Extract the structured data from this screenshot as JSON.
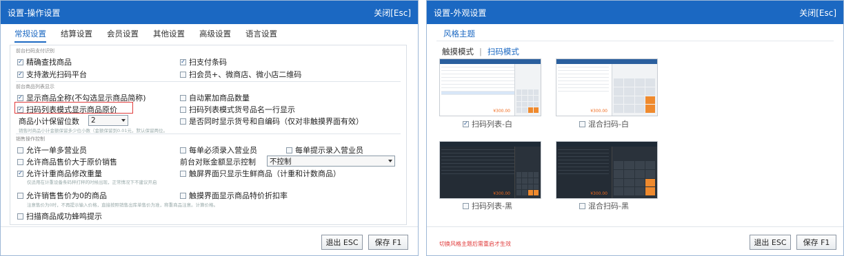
{
  "left": {
    "title": "设置-操作设置",
    "close": "关闭[Esc]",
    "tabs": [
      "常规设置",
      "结算设置",
      "会员设置",
      "其他设置",
      "高级设置",
      "语言设置"
    ],
    "groups": {
      "g1": "前台扫码支付识别",
      "g2": "前台商品列表显示",
      "g3": "销售操作控制"
    },
    "options": {
      "o1": "精确查找商品",
      "o2": "扫支付条码",
      "o3": "支持激光扫码平台",
      "o4": "扫会员+、微商店、微小店二维码",
      "o5": "显示商品全称(不勾选显示商品简称)",
      "o6": "自动累加商品数量",
      "o7": "扫码列表模式显示商品原价",
      "o8": "扫码列表模式货号品名一行显示",
      "o9": "是否同时显示货号和自编码（仅对非触摸界面有效）",
      "o10": "允许一单多营业员",
      "o11": "每单必须录入营业员",
      "o12": "每单提示录入营业员",
      "o13": "允许商品售价大于原价销售",
      "o14": "允许计重商品修改重量",
      "o15": "触屏界面只显示生鲜商品（计重和计数商品）",
      "o16": "允许销售售价为0的商品",
      "o17": "触摸界面显示商品特价折扣率",
      "o18": "扫描商品成功蜂鸣提示"
    },
    "decimal_label": "商品小计保留位数",
    "decimal_value": "2",
    "hint1": "销售时商品小计金额保留多少位小数（金额保留到0.01元，默认保留两位。",
    "hint2": "仅适用在计重设备条码秤打秤的时候出现，正常情况下不建议开启",
    "hint3": "注意售价为0时，不再提示输入价格，直接按照销售出库单售价为准，称重商品注意。计算价格。",
    "amount_label": "前台对账金额显示控制",
    "amount_value": "不控制",
    "btn_exit": "退出 ESC",
    "btn_save": "保存 F1"
  },
  "right": {
    "title": "设置-外观设置",
    "close": "关闭[Esc]",
    "theme_link": "风格主题",
    "mode_touch": "触摸模式",
    "mode_sep": "|",
    "mode_scan": "扫码模式",
    "themes": [
      "扫码列表-白",
      "混合扫码-白",
      "扫码列表-黑",
      "混合扫码-黑"
    ],
    "thumb_total": "¥300.00",
    "warning": "切换风格主题后需重启才生效",
    "btn_exit": "退出 ESC",
    "btn_save": "保存 F1"
  },
  "colors": {
    "accent": "#1b68c2",
    "warn": "#e03a3a",
    "orange": "#ef8a2e"
  }
}
